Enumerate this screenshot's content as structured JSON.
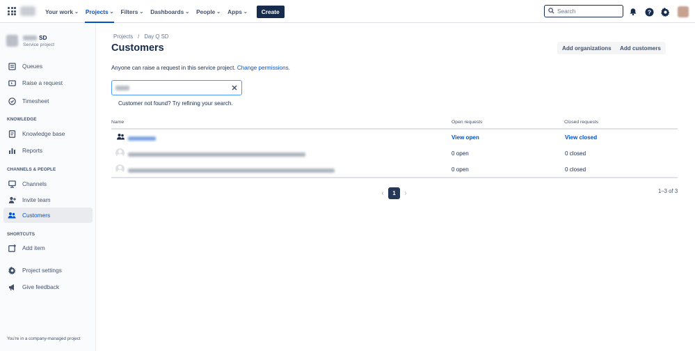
{
  "topbar": {
    "nav": [
      {
        "label": "Your work",
        "active": false
      },
      {
        "label": "Projects",
        "active": true
      },
      {
        "label": "Filters",
        "active": false
      },
      {
        "label": "Dashboards",
        "active": false
      },
      {
        "label": "People",
        "active": false
      },
      {
        "label": "Apps",
        "active": false
      }
    ],
    "create_label": "Create",
    "search_placeholder": "Search",
    "icons": [
      "notifications-icon",
      "help-icon",
      "settings-icon"
    ]
  },
  "sidebar": {
    "project_name": "SD",
    "project_type": "Service project",
    "items_top": [
      {
        "label": "Queues",
        "icon": "queues-icon"
      },
      {
        "label": "Raise a request",
        "icon": "raise-request-icon"
      },
      {
        "label": "Timesheet",
        "icon": "timesheet-icon"
      }
    ],
    "section_knowledge": "KNOWLEDGE",
    "items_knowledge": [
      {
        "label": "Knowledge base",
        "icon": "knowledge-base-icon"
      },
      {
        "label": "Reports",
        "icon": "reports-icon"
      }
    ],
    "section_channels": "CHANNELS & PEOPLE",
    "items_channels": [
      {
        "label": "Channels",
        "icon": "channels-icon"
      },
      {
        "label": "Invite team",
        "icon": "invite-team-icon"
      },
      {
        "label": "Customers",
        "icon": "customers-icon",
        "active": true
      }
    ],
    "section_shortcuts": "SHORTCUTS",
    "items_shortcuts": [
      {
        "label": "Add item",
        "icon": "add-item-icon"
      }
    ],
    "items_bottom": [
      {
        "label": "Project settings",
        "icon": "project-settings-icon"
      },
      {
        "label": "Give feedback",
        "icon": "give-feedback-icon"
      }
    ],
    "footer": "You're in a company-managed project"
  },
  "main": {
    "breadcrumb": [
      "Projects",
      "Day Q SD"
    ],
    "title": "Customers",
    "add_organizations": "Add organizations",
    "add_customers": "Add customers",
    "info_text": "Anyone can raise a request in this service project.",
    "info_link": "Change permissions.",
    "not_found": "Customer not found? Try refining your search.",
    "table": {
      "headers": [
        "Name",
        "Open requests",
        "Closed requests"
      ],
      "rows": [
        {
          "open": "View open",
          "closed": "View closed",
          "is_org": true
        },
        {
          "open": "0 open",
          "closed": "0 closed",
          "is_org": false
        },
        {
          "open": "0 open",
          "closed": "0 closed",
          "is_org": false
        }
      ]
    },
    "pagination": {
      "current_page": "1"
    },
    "count": "1–3 of 3"
  }
}
